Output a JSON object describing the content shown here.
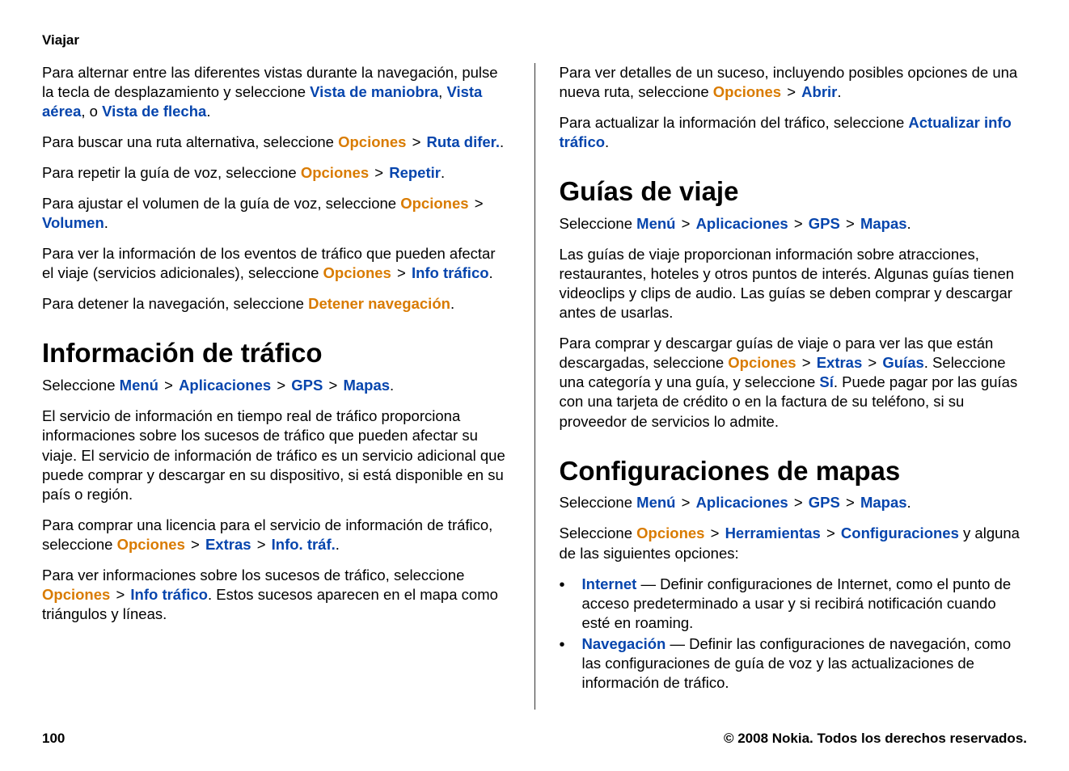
{
  "header": "Viajar",
  "left": {
    "p1_a": "Para alternar entre las diferentes vistas durante la navegación, pulse la tecla de desplazamiento y seleccione ",
    "p1_l1": "Vista de maniobra",
    "p1_b": ", ",
    "p1_l2": "Vista aérea",
    "p1_c": ", o ",
    "p1_l3": "Vista de flecha",
    "p1_d": ".",
    "p2_a": "Para buscar una ruta alternativa, seleccione ",
    "p2_l1": "Opciones",
    "p2_l2": "Ruta difer.",
    "p2_b": ".",
    "p3_a": "Para repetir la guía de voz, seleccione ",
    "p3_l1": "Opciones",
    "p3_l2": "Repetir",
    "p3_b": ".",
    "p4_a": "Para ajustar el volumen de la guía de voz, seleccione ",
    "p4_l1": "Opciones",
    "p4_l2": "Volumen",
    "p4_b": ".",
    "p5_a": "Para ver la información de los eventos de tráfico que pueden afectar el viaje (servicios adicionales), seleccione ",
    "p5_l1": "Opciones",
    "p5_l2": "Info tráfico",
    "p5_b": ".",
    "p6_a": "Para detener la navegación, seleccione ",
    "p6_l1": "Detener navegación",
    "p6_b": ".",
    "h2_traffic": "Información de tráfico",
    "p7_a": "Seleccione ",
    "p7_l1": "Menú",
    "p7_l2": "Aplicaciones",
    "p7_l3": "GPS",
    "p7_l4": "Mapas",
    "p7_b": ".",
    "p8": "El servicio de información en tiempo real de tráfico proporciona informaciones sobre los sucesos de tráfico que pueden afectar su viaje. El servicio de información de tráfico es un servicio adicional que puede comprar y descargar en su dispositivo, si está disponible en su país o región.",
    "p9_a": "Para comprar una licencia para el servicio de información de tráfico, seleccione ",
    "p9_l1": "Opciones",
    "p9_l2": "Extras",
    "p9_l3": "Info. tráf.",
    "p9_b": ".",
    "p10_a": "Para ver informaciones sobre los sucesos de tráfico, seleccione ",
    "p10_l1": "Opciones",
    "p10_l2": "Info tráfico",
    "p10_b": ". Estos sucesos aparecen en el mapa como triángulos y líneas."
  },
  "right": {
    "p1_a": "Para ver detalles de un suceso, incluyendo posibles opciones de una nueva ruta, seleccione ",
    "p1_l1": "Opciones",
    "p1_l2": "Abrir",
    "p1_b": ".",
    "p2_a": "Para actualizar la información del tráfico, seleccione ",
    "p2_l1": "Actualizar info tráfico",
    "p2_b": ".",
    "h2_guides": "Guías de viaje",
    "p3_a": "Seleccione ",
    "p3_l1": "Menú",
    "p3_l2": "Aplicaciones",
    "p3_l3": "GPS",
    "p3_l4": "Mapas",
    "p3_b": ".",
    "p4": "Las guías de viaje proporcionan información sobre atracciones, restaurantes, hoteles y otros puntos de interés. Algunas guías tienen videoclips y clips de audio. Las guías se deben comprar y descargar antes de usarlas.",
    "p5_a": "Para comprar y descargar guías de viaje o para ver las que están descargadas, seleccione ",
    "p5_l1": "Opciones",
    "p5_l2": "Extras",
    "p5_l3": "Guías",
    "p5_b": ". Seleccione una categoría y una guía, y seleccione ",
    "p5_l4": "Sí",
    "p5_c": ". Puede pagar por las guías con una tarjeta de crédito o en la factura de su teléfono, si su proveedor de servicios lo admite.",
    "h2_config": "Configuraciones de mapas",
    "p6_a": "Seleccione ",
    "p6_l1": "Menú",
    "p6_l2": "Aplicaciones",
    "p6_l3": "GPS",
    "p6_l4": "Mapas",
    "p6_b": ".",
    "p7_a": "Seleccione ",
    "p7_l1": "Opciones",
    "p7_l2": "Herramientas",
    "p7_l3": "Configuraciones",
    "p7_b": " y alguna de las siguientes opciones:",
    "b1_l": "Internet",
    "b1_t": "  — Definir configuraciones de Internet, como el punto de acceso predeterminado a usar y si recibirá notificación cuando esté en roaming.",
    "b2_l": "Navegación",
    "b2_t": "  — Definir las configuraciones de navegación, como las configuraciones de guía de voz y las actualizaciones de información de tráfico."
  },
  "footer": {
    "page": "100",
    "copyright": "© 2008 Nokia. Todos los derechos reservados."
  },
  "gt": ">"
}
